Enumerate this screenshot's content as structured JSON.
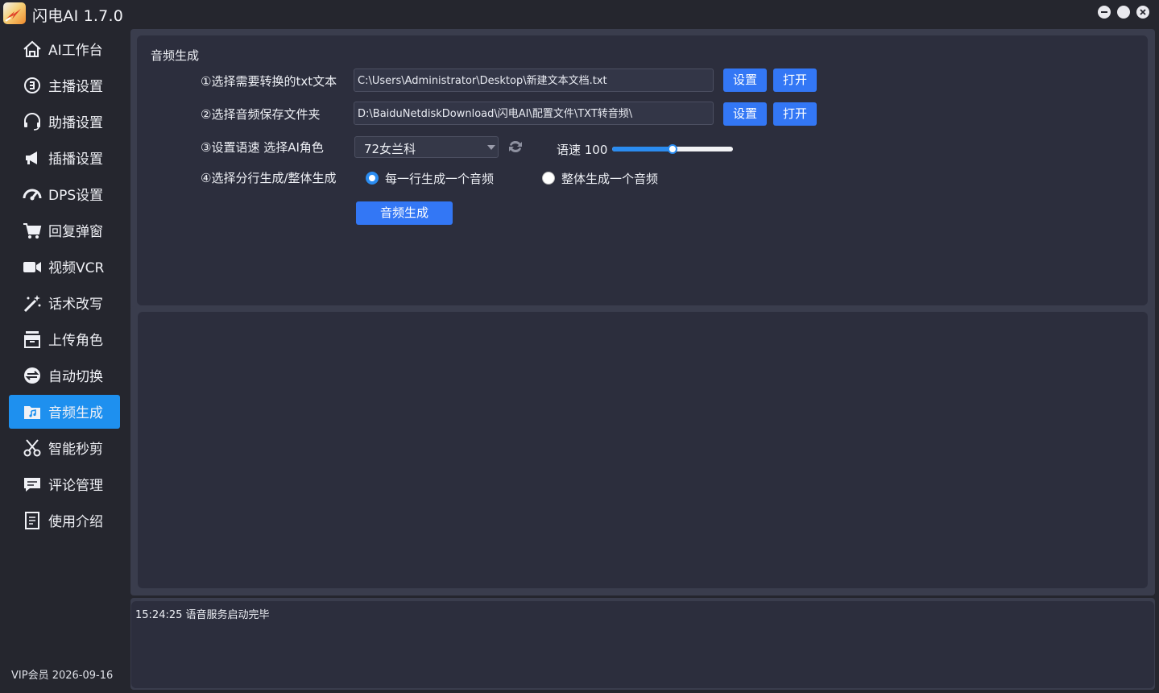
{
  "window": {
    "title": "闪电AI 1.7.0",
    "controls": [
      "minimize",
      "maximize",
      "close"
    ]
  },
  "sidebar": {
    "items": [
      {
        "label": "AI工作台",
        "icon": "home-icon"
      },
      {
        "label": "主播设置",
        "icon": "anchor-icon"
      },
      {
        "label": "助播设置",
        "icon": "headset-icon"
      },
      {
        "label": "插播设置",
        "icon": "megaphone-icon"
      },
      {
        "label": "DPS设置",
        "icon": "gauge-icon"
      },
      {
        "label": "回复弹窗",
        "icon": "cart-icon"
      },
      {
        "label": "视频VCR",
        "icon": "video-camera-icon"
      },
      {
        "label": "话术改写",
        "icon": "magic-wand-icon"
      },
      {
        "label": "上传角色",
        "icon": "archive-box-icon"
      },
      {
        "label": "自动切换",
        "icon": "switch-icon"
      },
      {
        "label": "音频生成",
        "icon": "music-folder-icon",
        "active": true
      },
      {
        "label": "智能秒剪",
        "icon": "scissors-icon"
      },
      {
        "label": "评论管理",
        "icon": "comment-icon"
      },
      {
        "label": "使用介绍",
        "icon": "document-icon"
      }
    ],
    "vip_text": "VIP会员  2026-09-16",
    "active_color": "#1e90ef"
  },
  "panel": {
    "title": "音频生成",
    "row1": {
      "label": "①选择需要转换的txt文本",
      "value": "C:\\Users\\Administrator\\Desktop\\新建文本文档.txt",
      "set_label": "设置",
      "open_label": "打开"
    },
    "row2": {
      "label": "②选择音频保存文件夹",
      "value": "D:\\BaiduNetdiskDownload\\闪电AI\\配置文件\\TXT转音频\\",
      "set_label": "设置",
      "open_label": "打开"
    },
    "row3": {
      "label": "③设置语速 选择AI角色",
      "voice_selected": "72女兰科",
      "speed_label": "语速 100",
      "speed_fraction": 0.5
    },
    "row4": {
      "label": "④选择分行生成/整体生成",
      "option_per_line": "每一行生成一个音频",
      "option_whole": "整体生成一个音频",
      "selected": "per_line"
    },
    "generate_label": "音频生成"
  },
  "log": {
    "lines": [
      "15:24:25 语音服务启动完毕"
    ]
  },
  "colors": {
    "button_blue": "#3377f5",
    "accent_blue": "#2b8cf0",
    "background": "#25262e",
    "panel": "#2c2e3d"
  }
}
